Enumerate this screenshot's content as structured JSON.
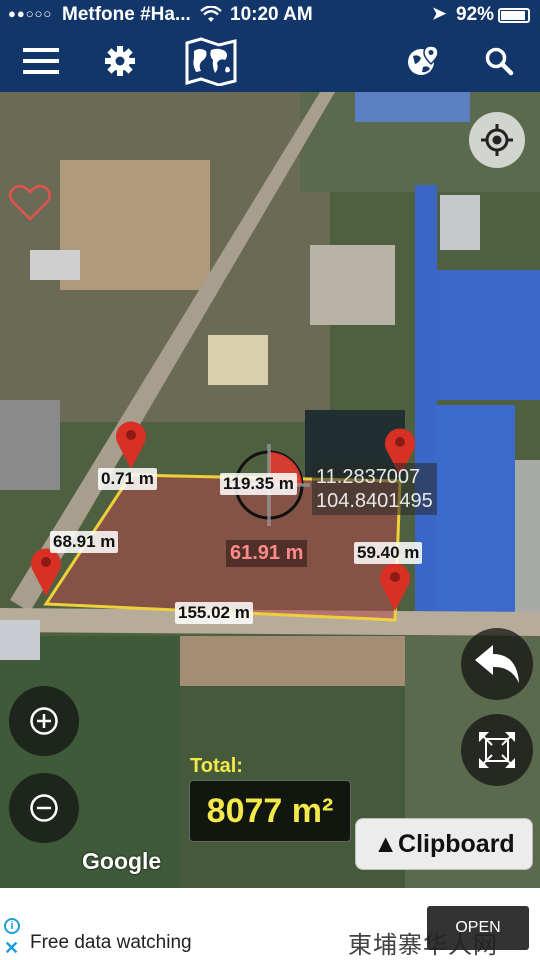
{
  "status_bar": {
    "signal": "●●○○○",
    "carrier": "Metfone #Ha...",
    "time": "10:20 AM",
    "battery": "92%"
  },
  "toolbar": {
    "icons": [
      "menu-icon",
      "settings-icon",
      "world-map-icon",
      "globe-pin-icon",
      "search-icon"
    ]
  },
  "map": {
    "segment_labels": [
      "0.71 m",
      "119.35 m",
      "68.91 m",
      "59.40 m",
      "155.02 m"
    ],
    "coords": {
      "lat": "11.2837007",
      "lng": "104.8401495"
    },
    "area_label": "61.91 m",
    "google": "Google"
  },
  "total": {
    "title": "Total:",
    "value": "8077 m²"
  },
  "clipboard_label": "▲Clipboard",
  "ad": {
    "text": "Free data watching",
    "button": "OPEN",
    "watermark": "東埔寨华人网"
  },
  "colors": {
    "toolbar_bg": "#12366a",
    "polygon_line": "#f0d03a",
    "polygon_fill": "#b03a3a",
    "pin": "#d93025",
    "total_text": "#f4e94a"
  }
}
